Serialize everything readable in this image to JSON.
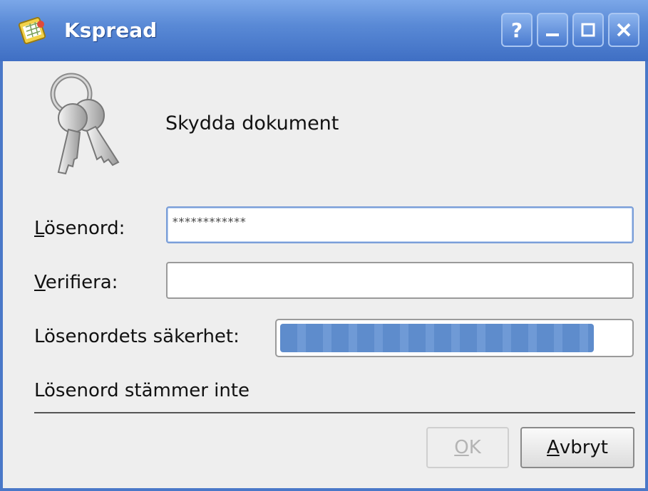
{
  "window": {
    "title": "Kspread",
    "help_label": "?"
  },
  "dialog": {
    "heading": "Skydda dokument",
    "password": {
      "label_accel": "L",
      "label_rest": "ösenord:",
      "value": "************"
    },
    "verify": {
      "label_accel": "V",
      "label_rest": "erifiera:",
      "value": ""
    },
    "strength": {
      "label": "Lösenordets säkerhet:",
      "level_percent": 90
    },
    "status": "Lösenord stämmer inte",
    "buttons": {
      "ok_accel": "O",
      "ok_rest": "K",
      "ok_enabled": false,
      "cancel_accel": "A",
      "cancel_rest": "vbryt"
    }
  },
  "colors": {
    "titlebar": "#4a7bd0",
    "strength_bar": "#6691d2"
  },
  "icons": [
    "kspread-app-icon",
    "help-icon",
    "minimize-icon",
    "maximize-icon",
    "close-icon",
    "keys-icon"
  ]
}
